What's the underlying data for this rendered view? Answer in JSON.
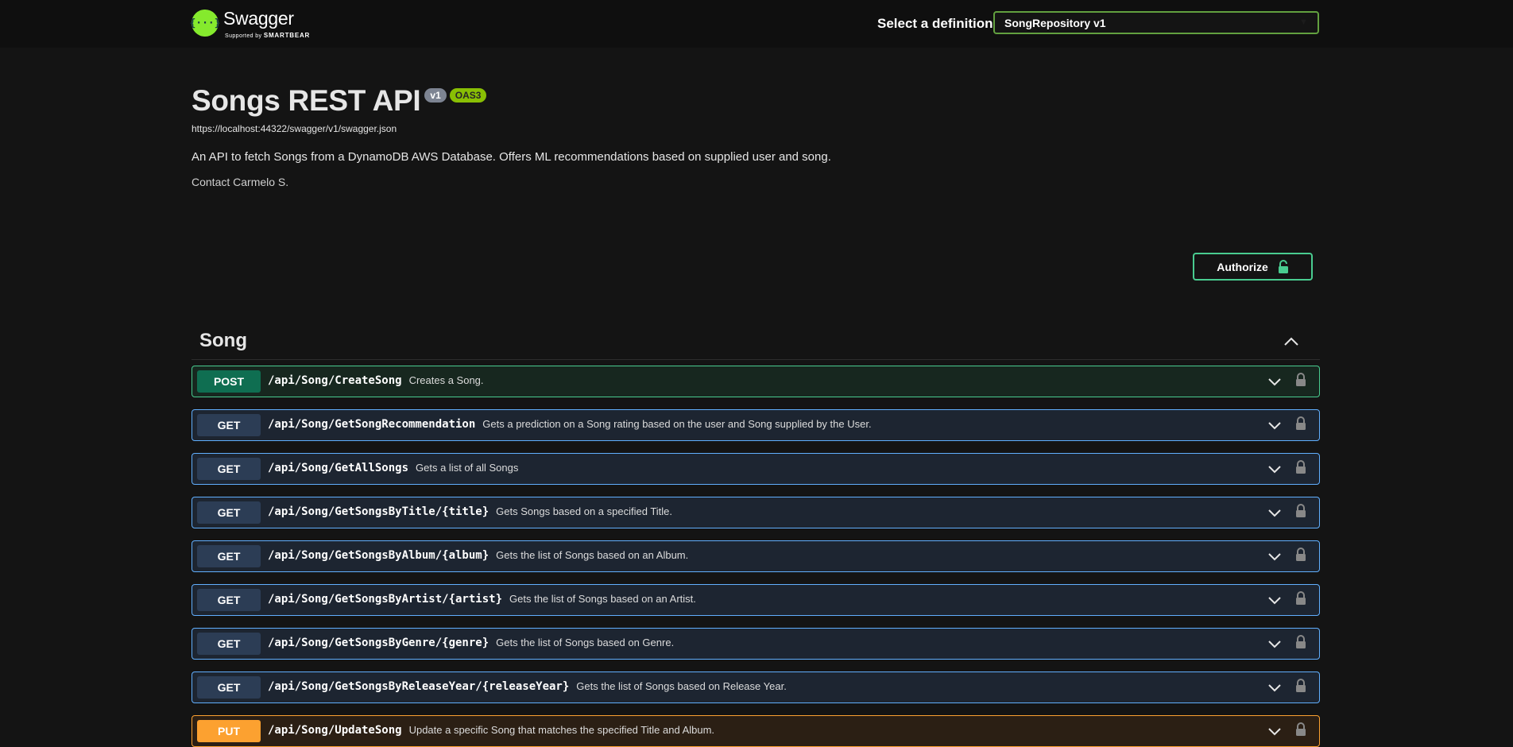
{
  "topbar": {
    "logo_name": "Swagger",
    "logo_sub_prefix": "Supported by",
    "logo_sub_brand": "SMARTBEAR",
    "definition_label": "Select a definition",
    "definition_selected": "SongRepository v1"
  },
  "info": {
    "title": "Songs REST API",
    "version_badge": "v1",
    "oas_badge": "OAS3",
    "spec_url": "https://localhost:44322/swagger/v1/swagger.json",
    "description": "An API to fetch Songs from a DynamoDB AWS Database. Offers ML recommendations based on supplied user and song.",
    "contact": "Contact Carmelo S."
  },
  "authorize": {
    "label": "Authorize"
  },
  "section": {
    "title": "Song"
  },
  "operations": [
    {
      "method": "POST",
      "path": "/api/Song/CreateSong",
      "summary": "Creates a Song."
    },
    {
      "method": "GET",
      "path": "/api/Song/GetSongRecommendation",
      "summary": "Gets a prediction on a Song rating based on the user and Song supplied by the User."
    },
    {
      "method": "GET",
      "path": "/api/Song/GetAllSongs",
      "summary": "Gets a list of all Songs"
    },
    {
      "method": "GET",
      "path": "/api/Song/GetSongsByTitle/{title}",
      "summary": "Gets Songs based on a specified Title."
    },
    {
      "method": "GET",
      "path": "/api/Song/GetSongsByAlbum/{album}",
      "summary": "Gets the list of Songs based on an Album."
    },
    {
      "method": "GET",
      "path": "/api/Song/GetSongsByArtist/{artist}",
      "summary": "Gets the list of Songs based on an Artist."
    },
    {
      "method": "GET",
      "path": "/api/Song/GetSongsByGenre/{genre}",
      "summary": "Gets the list of Songs based on Genre."
    },
    {
      "method": "GET",
      "path": "/api/Song/GetSongsByReleaseYear/{releaseYear}",
      "summary": "Gets the list of Songs based on Release Year."
    },
    {
      "method": "PUT",
      "path": "/api/Song/UpdateSong",
      "summary": "Update a specific Song that matches the specified Title and Album."
    }
  ],
  "colors": {
    "post": "#49cc90",
    "get": "#61affe",
    "put": "#fca130",
    "swagger_green": "#85ea2d"
  }
}
